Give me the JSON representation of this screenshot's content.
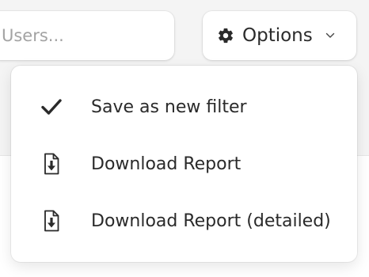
{
  "search": {
    "placeholder": "Users..."
  },
  "options_button": {
    "label": "Options",
    "icon": "gear-icon",
    "dropdown_icon": "chevron-down-icon"
  },
  "menu": {
    "items": [
      {
        "label": "Save as new filter",
        "icon": "checkmark-icon"
      },
      {
        "label": "Download Report",
        "icon": "download-file-icon"
      },
      {
        "label": "Download Report (detailed)",
        "icon": "download-file-icon"
      }
    ]
  },
  "colors": {
    "background": "#f4f4f4",
    "surface": "#ffffff",
    "text": "#2a2a2a",
    "placeholder": "#a3a3a3"
  }
}
